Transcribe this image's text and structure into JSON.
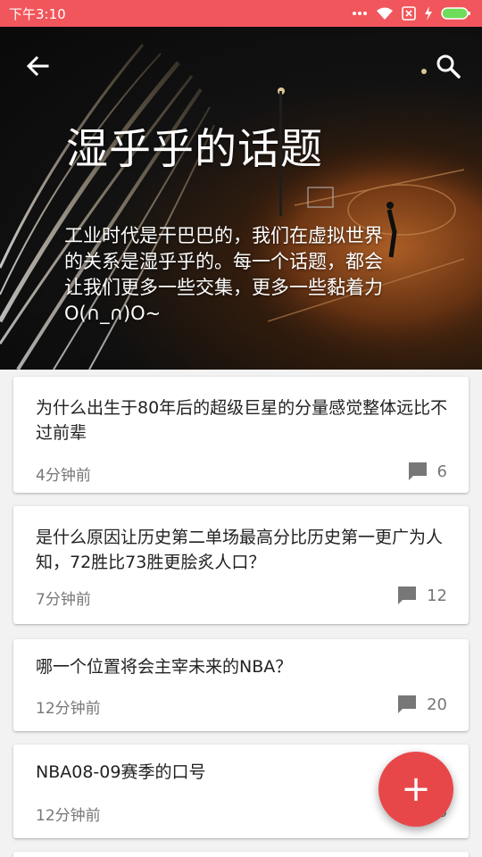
{
  "status_bar": {
    "time": "下午3:10"
  },
  "header": {
    "title": "湿乎乎的话题",
    "description": "工业时代是干巴巴的，我们在虚拟世界的关系是湿乎乎的。每一个话题，都会让我们更多一些交集，更多一些黏着力O(∩_∩)O~",
    "back_icon": "arrow-back-icon",
    "search_icon": "search-icon"
  },
  "topics": [
    {
      "title": "为什么出生于80年后的超级巨星的分量感觉整体远比不过前辈",
      "time": "4分钟前",
      "comments": "6"
    },
    {
      "title": "是什么原因让历史第二单场最高分比历史第一更广为人知，72胜比73胜更脍炙人口？",
      "time": "7分钟前",
      "comments": "12"
    },
    {
      "title": "哪一个位置将会主宰未来的NBA？",
      "time": "12分钟前",
      "comments": "20"
    },
    {
      "title": "NBA08-09赛季的口号",
      "time": "12分钟前",
      "comments": "6"
    }
  ],
  "fab": {
    "icon": "plus-icon",
    "label": "+"
  },
  "colors": {
    "status_bar": "#f0565b",
    "fab": "#e8474a",
    "meta_text": "#777777"
  }
}
